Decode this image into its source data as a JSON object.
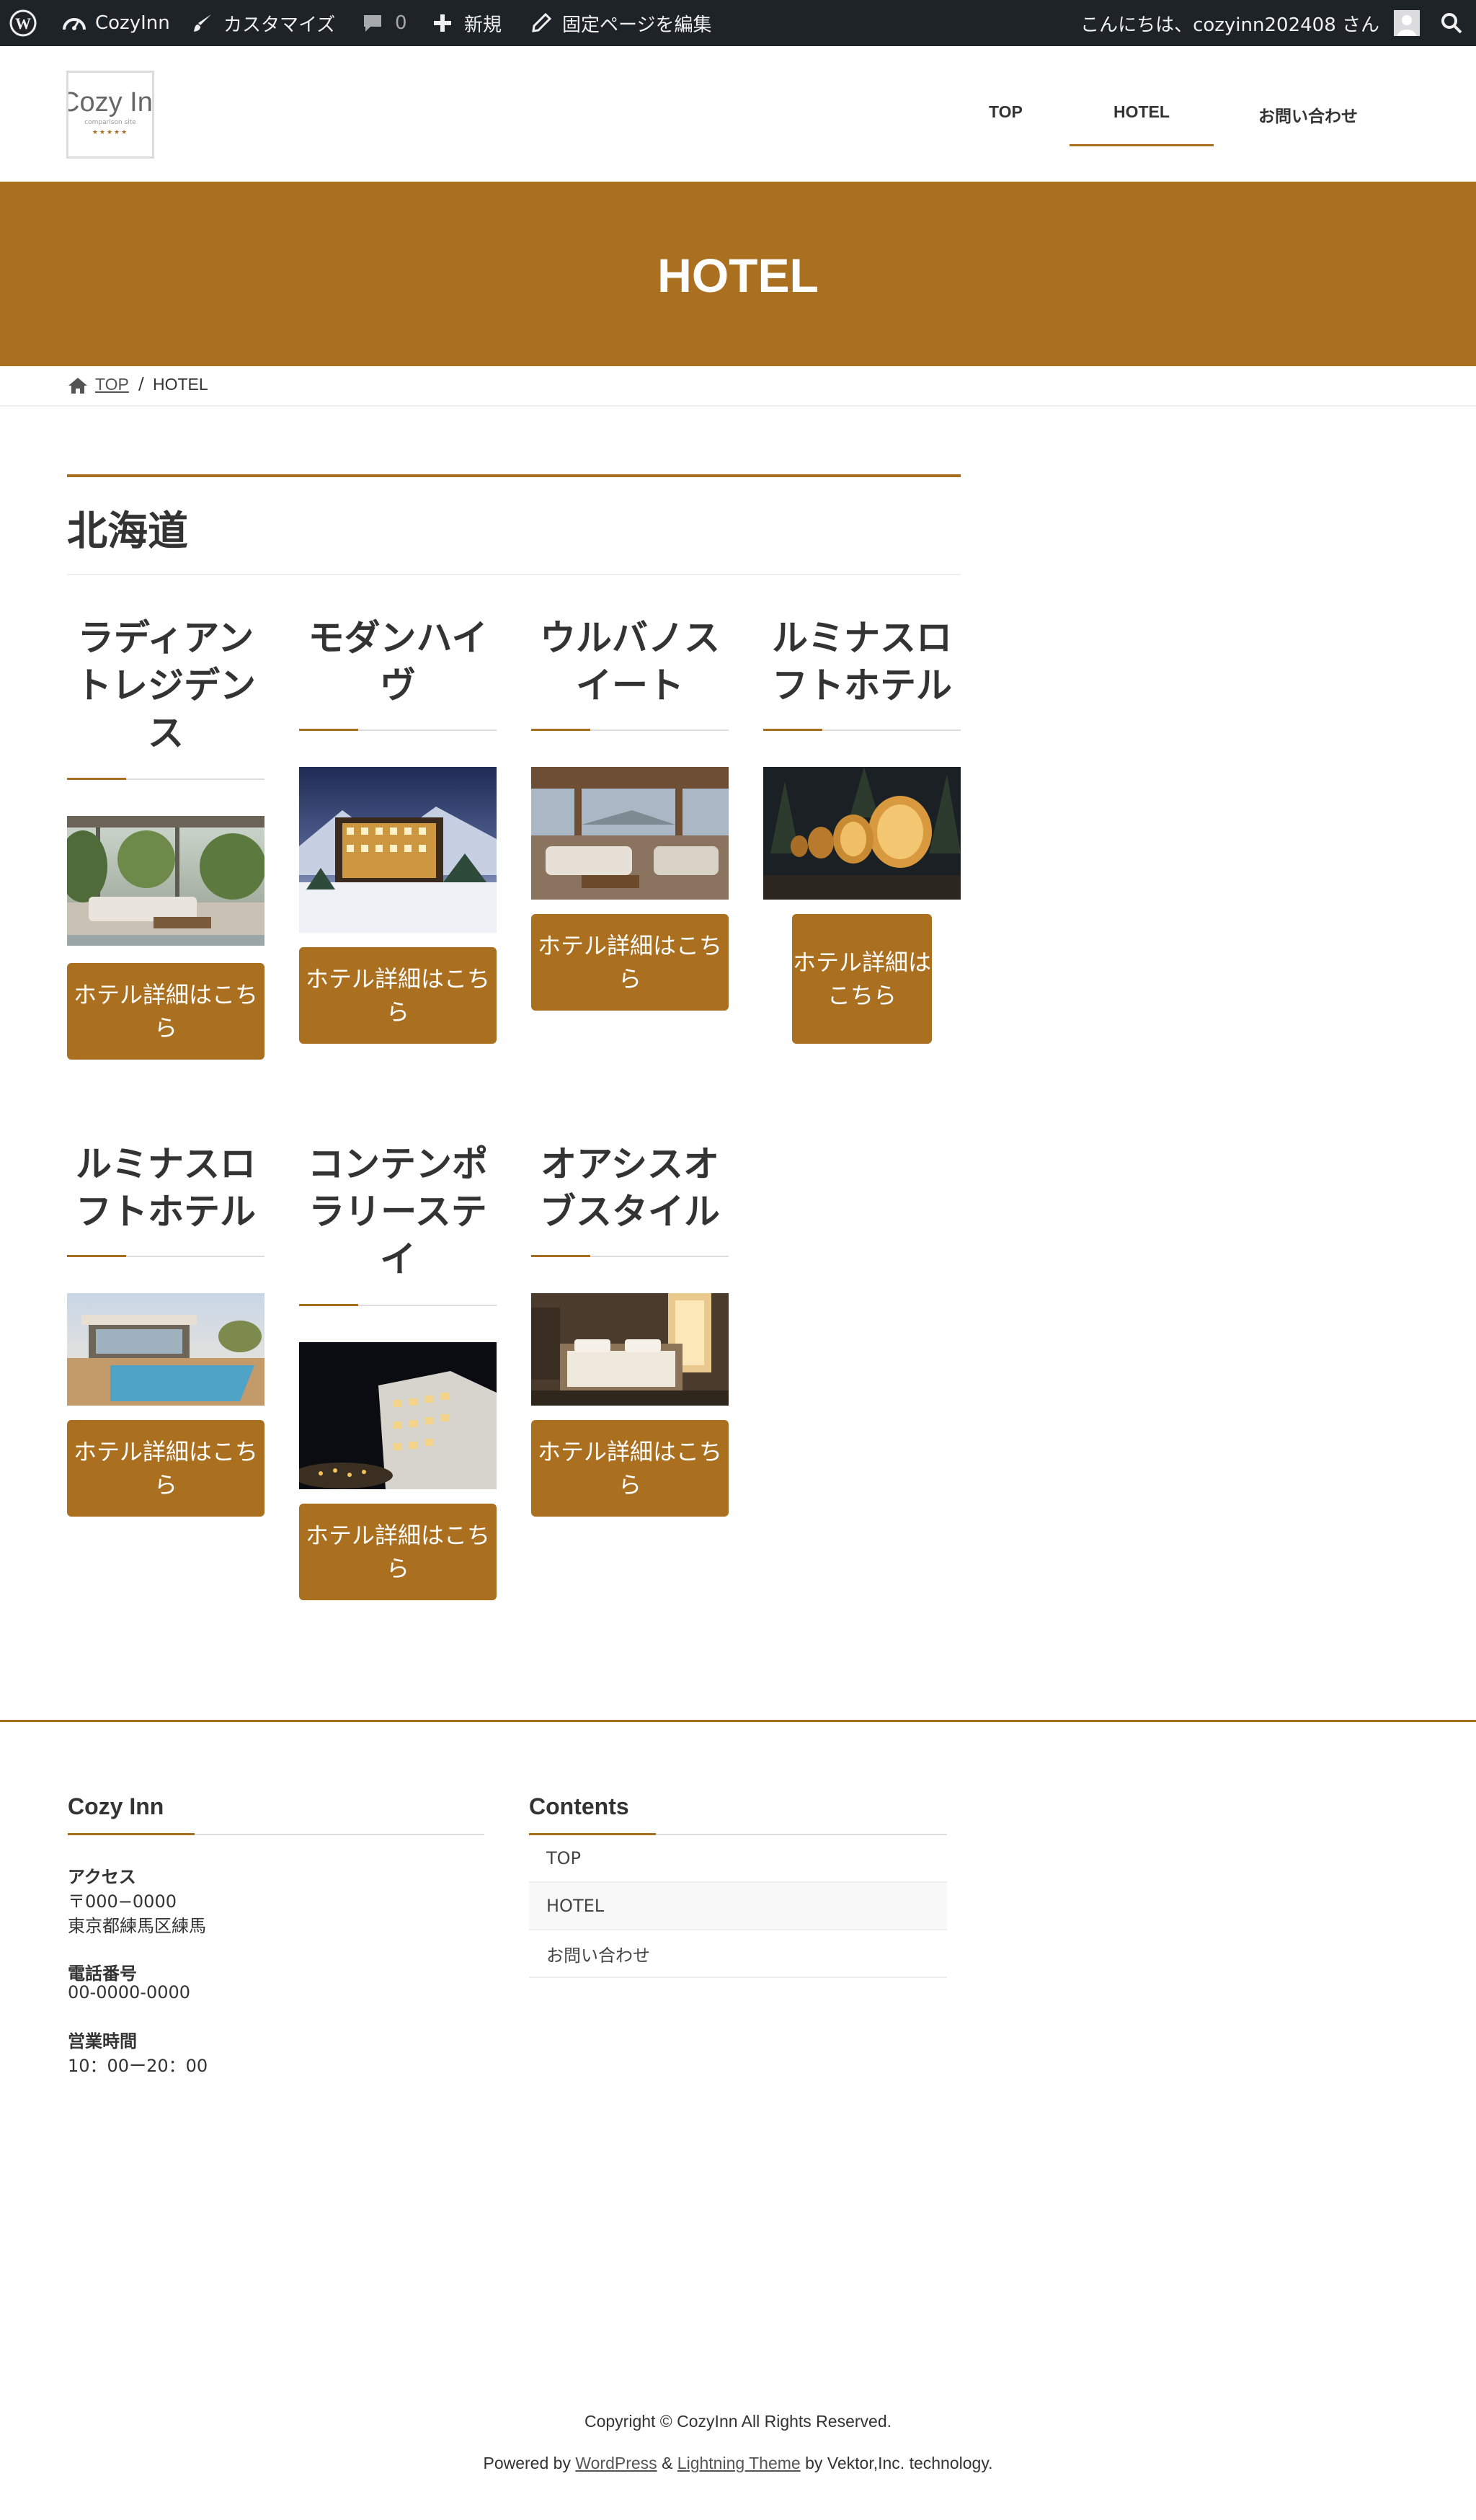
{
  "admin_bar": {
    "site_name": "CozyInn",
    "customize": "カスタマイズ",
    "comments_count": "0",
    "new": "新規",
    "edit_page": "固定ページを編集",
    "greeting": "こんにちは、cozyinn202408 さん"
  },
  "header": {
    "logo_text": "Cozy Inn",
    "logo_sub": "comparison site",
    "logo_stars": "★★★★★",
    "nav": [
      "TOP",
      "HOTEL",
      "お問い合わせ"
    ],
    "active_nav": "HOTEL"
  },
  "banner": {
    "title": "HOTEL"
  },
  "breadcrumb": {
    "home": "TOP",
    "separator": "/",
    "current": "HOTEL"
  },
  "section": {
    "title": "北海道"
  },
  "hotels": [
    {
      "name": "ラディアントレジデンス",
      "button": "ホテル詳細はこちら"
    },
    {
      "name": "モダンハイヴ",
      "button": "ホテル詳細はこちら"
    },
    {
      "name": "ウルバノスイート",
      "button": "ホテル詳細はこちら"
    },
    {
      "name": "ルミナスロフトホテル",
      "button": "ホテル詳細はこちら"
    },
    {
      "name": "ルミナスロフトホテル",
      "button": "ホテル詳細はこちら"
    },
    {
      "name": "コンテンポラリーステイ",
      "button": "ホテル詳細はこちら"
    },
    {
      "name": "オアシスオブスタイル",
      "button": "ホテル詳細はこちら"
    }
  ],
  "footer": {
    "info_title": "Cozy Inn",
    "access_label": "アクセス",
    "postal": "〒000−0000",
    "address": "東京都練馬区練馬",
    "phone_label": "電話番号",
    "phone": "00-0000-0000",
    "hours_label": "営業時間",
    "hours": "10：00ー20：00",
    "contents_title": "Contents",
    "menu": [
      "TOP",
      "HOTEL",
      "お問い合わせ"
    ],
    "copyright": "Copyright © CozyInn All Rights Reserved.",
    "powered_prefix": "Powered by",
    "powered_wp": "WordPress",
    "powered_amp": "&",
    "powered_theme": "Lightning Theme",
    "powered_suffix": "by Vektor,Inc. technology."
  },
  "colors": {
    "accent": "#aa6f1f",
    "admin_bar": "#1d2327"
  }
}
